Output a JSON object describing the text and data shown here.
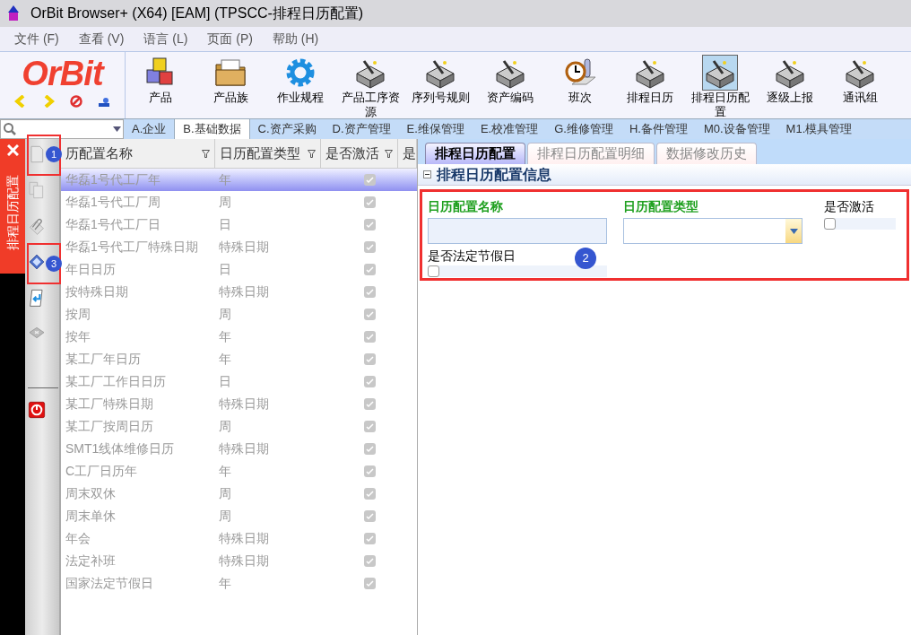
{
  "window": {
    "title": "OrBit Browser+ (X64) [EAM] (TPSCC-排程日历配置)"
  },
  "menu": [
    "文件 (F)",
    "查看 (V)",
    "语言 (L)",
    "页面 (P)",
    "帮助 (H)"
  ],
  "logo": {
    "text": "OrBit"
  },
  "toolbar": [
    {
      "label": "产品",
      "kind": "cubes",
      "selected": false
    },
    {
      "label": "产品族",
      "kind": "folder",
      "selected": false
    },
    {
      "label": "作业规程",
      "kind": "gear",
      "selected": false
    },
    {
      "label": "产品工序资源",
      "kind": "device",
      "selected": false
    },
    {
      "label": "序列号规则",
      "kind": "device",
      "selected": false
    },
    {
      "label": "资产编码",
      "kind": "device",
      "selected": false
    },
    {
      "label": "班次",
      "kind": "clock",
      "selected": false
    },
    {
      "label": "排程日历",
      "kind": "device",
      "selected": false
    },
    {
      "label": "排程日历配置",
      "kind": "device",
      "selected": true
    },
    {
      "label": "逐级上报",
      "kind": "device",
      "selected": false
    },
    {
      "label": "通讯组",
      "kind": "device",
      "selected": false
    }
  ],
  "module_tabs": [
    {
      "label": "A.企业",
      "selected": false
    },
    {
      "label": "B.基础数据",
      "selected": true
    },
    {
      "label": "C.资产采购",
      "selected": false
    },
    {
      "label": "D.资产管理",
      "selected": false
    },
    {
      "label": "E.维保管理",
      "selected": false
    },
    {
      "label": "E.校准管理",
      "selected": false
    },
    {
      "label": "G.维修管理",
      "selected": false
    },
    {
      "label": "H.备件管理",
      "selected": false
    },
    {
      "label": "M0.设备管理",
      "selected": false
    },
    {
      "label": "M1.模具管理",
      "selected": false
    }
  ],
  "side_tab": {
    "label": "排程日历配置"
  },
  "side_tools": [
    {
      "kind": "new"
    },
    {
      "kind": "copy"
    },
    {
      "kind": "attach"
    },
    {
      "kind": "save"
    },
    {
      "kind": "undo"
    },
    {
      "kind": "delete"
    },
    {
      "kind": "exit"
    }
  ],
  "grid": {
    "columns": [
      "历配置名称",
      "日历配置类型",
      "是否激活",
      "是"
    ],
    "rows": [
      {
        "name": "华磊1号代工厂年",
        "type": "年",
        "active": true,
        "selected": true
      },
      {
        "name": "华磊1号代工厂周",
        "type": "周",
        "active": true,
        "selected": false
      },
      {
        "name": "华磊1号代工厂日",
        "type": "日",
        "active": true,
        "selected": false
      },
      {
        "name": "华磊1号代工厂特殊日期",
        "type": "特殊日期",
        "active": true,
        "selected": false
      },
      {
        "name": "年日日历",
        "type": "日",
        "active": true,
        "selected": false
      },
      {
        "name": "按特殊日期",
        "type": "特殊日期",
        "active": true,
        "selected": false
      },
      {
        "name": "按周",
        "type": "周",
        "active": true,
        "selected": false
      },
      {
        "name": "按年",
        "type": "年",
        "active": true,
        "selected": false
      },
      {
        "name": "某工厂年日历",
        "type": "年",
        "active": true,
        "selected": false
      },
      {
        "name": "某工厂工作日日历",
        "type": "日",
        "active": true,
        "selected": false
      },
      {
        "name": "某工厂特殊日期",
        "type": "特殊日期",
        "active": true,
        "selected": false
      },
      {
        "name": "某工厂按周日历",
        "type": "周",
        "active": true,
        "selected": false
      },
      {
        "name": "SMT1线体维修日历",
        "type": "特殊日期",
        "active": true,
        "selected": false
      },
      {
        "name": "C工厂日历年",
        "type": "年",
        "active": true,
        "selected": false
      },
      {
        "name": "周末双休",
        "type": "周",
        "active": true,
        "selected": false
      },
      {
        "name": "周末单休",
        "type": "周",
        "active": true,
        "selected": false
      },
      {
        "name": "年会",
        "type": "特殊日期",
        "active": true,
        "selected": false
      },
      {
        "name": "法定补班",
        "type": "特殊日期",
        "active": true,
        "selected": false
      },
      {
        "name": "国家法定节假日",
        "type": "年",
        "active": true,
        "selected": false
      }
    ]
  },
  "detail_tabs": [
    {
      "label": "排程日历配置",
      "selected": true
    },
    {
      "label": "排程日历配置明细",
      "selected": false
    },
    {
      "label": "数据修改历史",
      "selected": false
    }
  ],
  "section": {
    "title": "排程日历配置信息",
    "expanded": true
  },
  "form": {
    "name_label": "日历配置名称",
    "type_label": "日历配置类型",
    "active_label": "是否激活",
    "active_checked": false,
    "holiday_label": "是否法定节假日",
    "holiday_checked": false
  },
  "callouts": [
    "1",
    "3",
    "2"
  ]
}
